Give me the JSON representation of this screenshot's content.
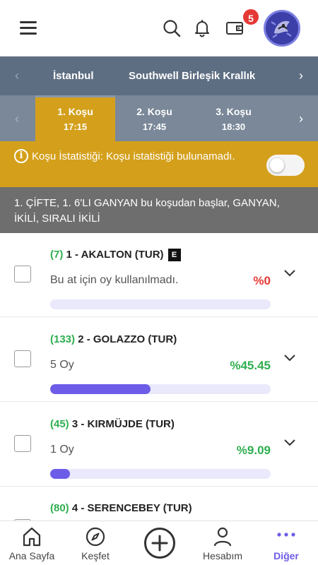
{
  "header": {
    "menu_icon": "hamburger-icon",
    "search_icon": "search-icon",
    "bell_icon": "bell-icon",
    "wallet_icon": "wallet-icon",
    "notification_count": "5",
    "avatar_icon": "user-avatar"
  },
  "cities": {
    "items": [
      "İstanbul",
      "Southwell Birleşik Krallık"
    ],
    "active_index": 0
  },
  "races": {
    "items": [
      {
        "label": "1. Koşu",
        "time": "17:15"
      },
      {
        "label": "2. Koşu",
        "time": "17:45"
      },
      {
        "label": "3. Koşu",
        "time": "18:30"
      }
    ],
    "active_index": 0
  },
  "stats": {
    "text": "Koşu İstatistiği: Koşu istatistiği bulunamadı.",
    "toggle_on": false
  },
  "bet_info": "1. ÇİFTE, 1. 6'LI GANYAN bu koşudan başlar, GANYAN, İKİLİ, SIRALI İKİLİ",
  "horses": [
    {
      "num": "(7)",
      "name": "1 - AKALTON (TUR)",
      "badge": "E",
      "votes": "Bu at için oy kullanılmadı.",
      "pct": "%0",
      "pct_color": "#e53935",
      "share": 0
    },
    {
      "num": "(133)",
      "name": "2 - GOLAZZO (TUR)",
      "badge": "",
      "votes": "5 Oy",
      "pct": "%45.45",
      "pct_color": "#2fae4f",
      "share": 0.4545
    },
    {
      "num": "(45)",
      "name": "3 - KIRMÜJDE (TUR)",
      "badge": "",
      "votes": "1 Oy",
      "pct": "%9.09",
      "pct_color": "#2fae4f",
      "share": 0.0909
    },
    {
      "num": "(80)",
      "name": "4 - SERENCEBEY (TUR)",
      "badge": "",
      "votes": "",
      "pct": "",
      "pct_color": "#2fae4f",
      "share": 0
    }
  ],
  "bottom_nav": {
    "items": [
      {
        "label": "Ana Sayfa",
        "icon": "home-icon"
      },
      {
        "label": "Keşfet",
        "icon": "compass-icon"
      },
      {
        "label": "",
        "icon": "add-circle-icon"
      },
      {
        "label": "Hesabım",
        "icon": "user-icon"
      },
      {
        "label": "Diğer",
        "icon": "more-icon"
      }
    ],
    "active_index": 4,
    "accent": "#6c5ce7"
  }
}
